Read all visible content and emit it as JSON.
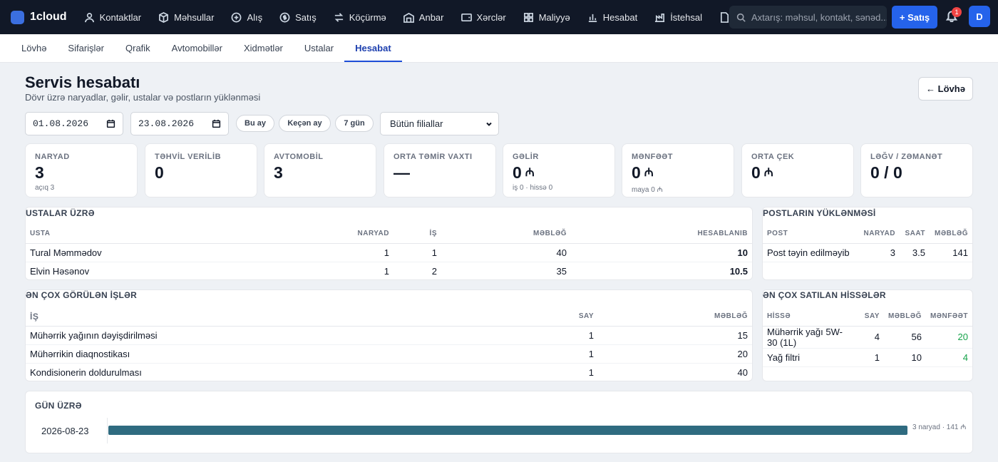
{
  "app": {
    "name": "1cloud"
  },
  "nav": [
    {
      "label": "Kontaktlar",
      "icon": "user-icon"
    },
    {
      "label": "Məhsullar",
      "icon": "box-icon"
    },
    {
      "label": "Alış",
      "icon": "plus-circle-icon"
    },
    {
      "label": "Satış",
      "icon": "dollar-circle-icon"
    },
    {
      "label": "Köçürmə",
      "icon": "transfer-icon"
    },
    {
      "label": "Anbar",
      "icon": "warehouse-icon"
    },
    {
      "label": "Xərclər",
      "icon": "wallet-icon"
    },
    {
      "label": "Maliyyə",
      "icon": "grid-icon"
    },
    {
      "label": "Hesabat",
      "icon": "bar-chart-icon"
    },
    {
      "label": "İstehsal",
      "icon": "factory-icon"
    }
  ],
  "search": {
    "placeholder": "Axtarış: məhsul, kontakt, sənəd..."
  },
  "header": {
    "sale_button": "+ Satış",
    "notification_count": "1",
    "avatar_initial": "D"
  },
  "tabs": [
    {
      "label": "Lövhə",
      "active": false
    },
    {
      "label": "Sifarişlər",
      "active": false
    },
    {
      "label": "Qrafik",
      "active": false
    },
    {
      "label": "Avtomobillər",
      "active": false
    },
    {
      "label": "Xidmətlər",
      "active": false
    },
    {
      "label": "Ustalar",
      "active": false
    },
    {
      "label": "Hesabat",
      "active": true
    }
  ],
  "page": {
    "title": "Servis hesabatı",
    "subtitle": "Dövr üzrə naryadlar, gəlir, ustalar və postların yüklənməsi",
    "back_button": "← Lövhə"
  },
  "filters": {
    "date_from": "01.08.2026",
    "date_to": "23.08.2026",
    "chips": [
      "Bu ay",
      "Keçən ay",
      "7 gün"
    ],
    "branch": "Bütün filiallar"
  },
  "kpis": [
    {
      "label": "NARYAD",
      "value": "3",
      "sub": "açıq 3",
      "icon": ""
    },
    {
      "label": "TƏHVİL VERİLİB",
      "value": "0",
      "sub": "",
      "icon": ""
    },
    {
      "label": "AVTOMOBİL",
      "value": "3",
      "sub": "",
      "icon": ""
    },
    {
      "label": "ORTA TƏMİR VAXTI",
      "value": "—",
      "sub": "",
      "icon": ""
    },
    {
      "label": "GƏLİR",
      "value": "0",
      "sub": "iş 0 · hissə 0",
      "icon": "manat-icon"
    },
    {
      "label": "MƏNFƏƏT",
      "value": "0",
      "sub": "maya 0 ₼",
      "icon": "manat-icon"
    },
    {
      "label": "ORTA ÇEK",
      "value": "0",
      "sub": "",
      "icon": "manat-icon"
    },
    {
      "label": "LƏĞV / ZƏMANƏT",
      "value": "0 / 0",
      "sub": "",
      "icon": ""
    }
  ],
  "masters": {
    "title": "USTALAR ÜZRƏ",
    "columns": [
      "USTA",
      "NARYAD",
      "İŞ",
      "MƏBLƏĞ",
      "HESABLANIB"
    ],
    "rows": [
      [
        "Tural Məmmədov",
        "1",
        "1",
        "40",
        "10"
      ],
      [
        "Elvin Həsənov",
        "1",
        "2",
        "35",
        "10.5"
      ]
    ]
  },
  "posts": {
    "title": "POSTLARIN YÜKLƏNMƏSİ",
    "columns": [
      "POST",
      "NARYAD",
      "SAAT",
      "MƏBLƏĞ"
    ],
    "rows": [
      [
        "Post təyin edilməyib",
        "3",
        "3.5",
        "141"
      ]
    ]
  },
  "top_works": {
    "title": "ƏN ÇOX GÖRÜLƏN İŞLƏR",
    "columns": [
      "İŞ",
      "SAY",
      "MƏBLƏĞ"
    ],
    "rows": [
      [
        "Mühərrik yağının dəyişdirilməsi",
        "1",
        "15"
      ],
      [
        "Mühərrikin diaqnostikası",
        "1",
        "20"
      ],
      [
        "Kondisionerin doldurulması",
        "1",
        "40"
      ]
    ]
  },
  "top_parts": {
    "title": "ƏN ÇOX SATILAN HİSSƏLƏR",
    "columns": [
      "HİSSƏ",
      "SAY",
      "MƏBLƏĞ",
      "MƏNFƏƏT"
    ],
    "rows": [
      [
        "Mühərrik yağı 5W-30 (1L)",
        "4",
        "56",
        "20"
      ],
      [
        "Yağ filtri",
        "1",
        "10",
        "4"
      ]
    ]
  },
  "by_day": {
    "title": "GÜN ÜZRƏ",
    "rows": [
      {
        "date": "2026-08-23",
        "fill": 1.0,
        "label": "3 naryad · 141 ₼"
      }
    ]
  }
}
